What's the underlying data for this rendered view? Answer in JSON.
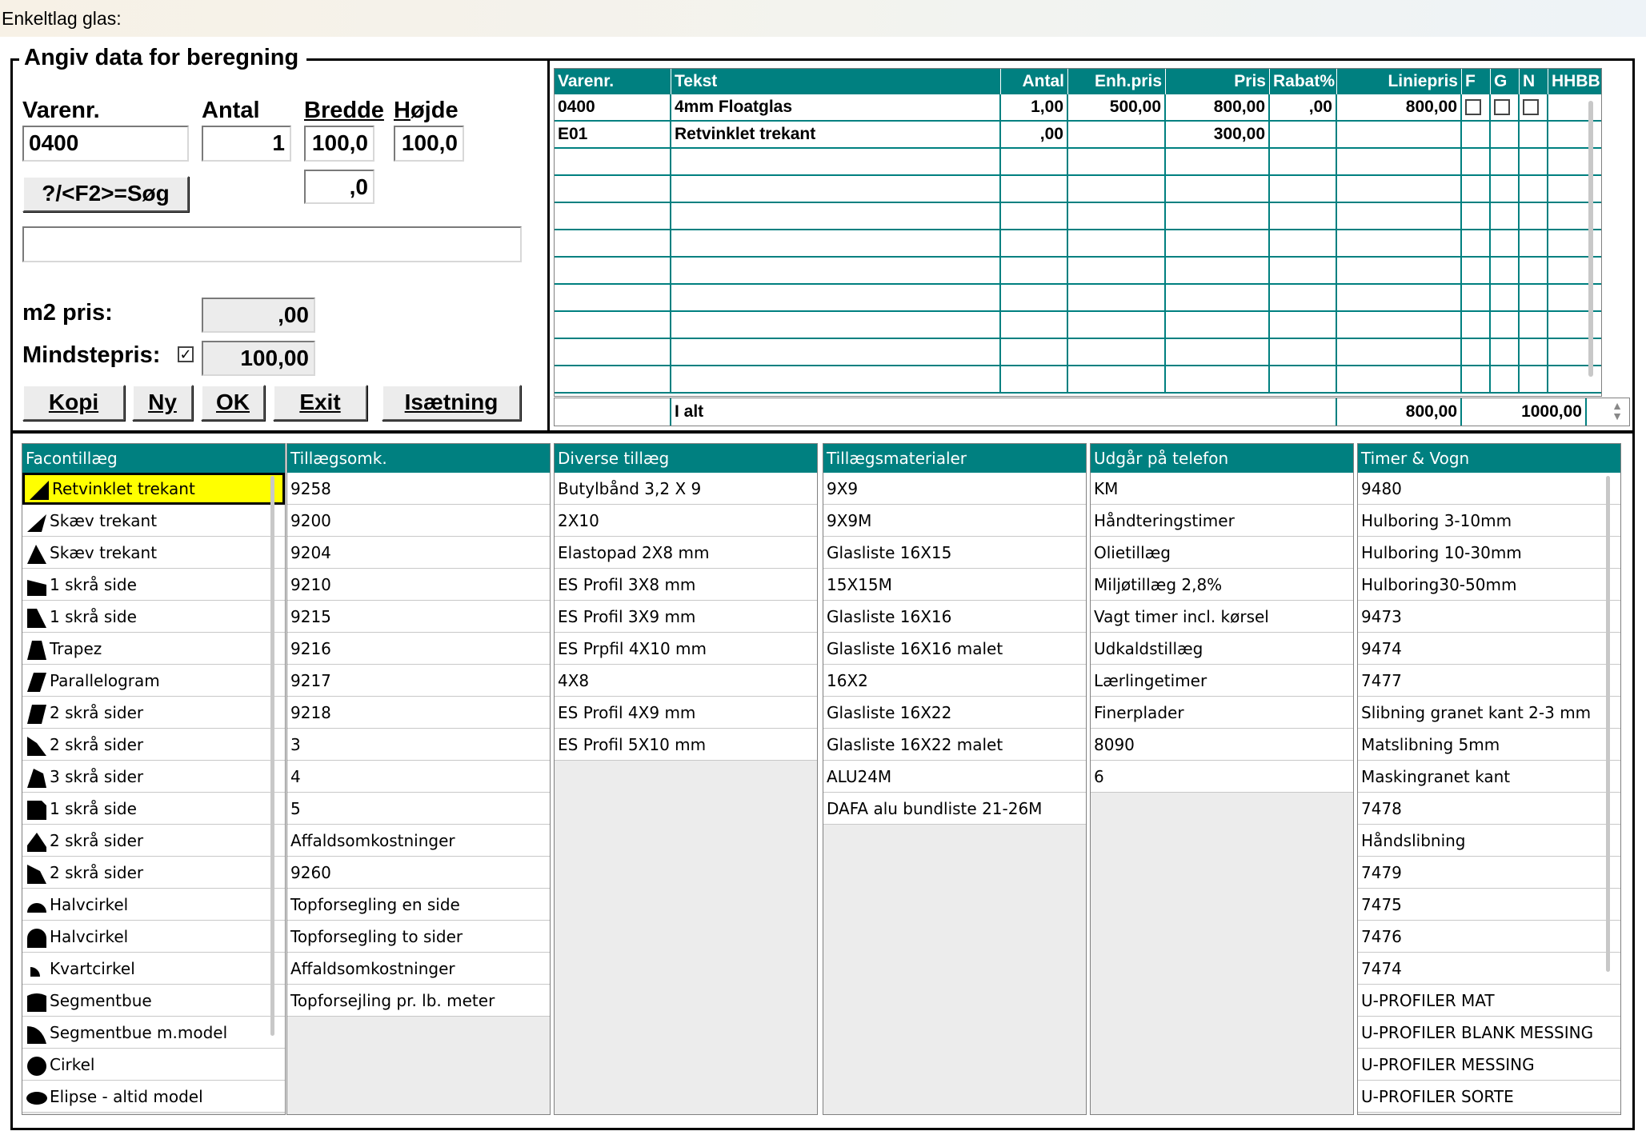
{
  "window": {
    "title": "Enkeltlag glas:"
  },
  "form": {
    "legend": "Angiv data for beregning",
    "varenr_label": "Varenr.",
    "antal_label": "Antal",
    "bredde_label": "Bredde",
    "hojde_label": "Højde",
    "varenr_value": "0400",
    "antal_value": "1",
    "bredde_value": "100,0",
    "hojde_value": "100,0",
    "extra_value": ",0",
    "search_button": "?/<F2>=Søg",
    "description_value": "",
    "m2_label": "m2 pris:",
    "m2_value": ",00",
    "mindstepris_label": "Mindstepris:",
    "mindstepris_checked": "✓",
    "mindstepris_value": "100,00",
    "buttons": {
      "kopi": "Kopi",
      "ny": "Ny",
      "ok": "OK",
      "exit": "Exit",
      "isaetning": "Isætning"
    }
  },
  "grid": {
    "columns": [
      "Varenr.",
      "Tekst",
      "Antal",
      "Enh.pris",
      "Pris",
      "Rabat%",
      "Liniepris",
      "F",
      "G",
      "N",
      "HHBB"
    ],
    "rows": [
      [
        "0400",
        "4mm Floatglas",
        "1,00",
        "500,00",
        "800,00",
        ",00",
        "800,00"
      ],
      [
        "E01",
        "Retvinklet trekant",
        ",00",
        "",
        "300,00",
        "",
        ""
      ]
    ],
    "totals": {
      "label": "I alt",
      "liniepris": "800,00",
      "total": "1000,00"
    }
  },
  "lists": {
    "facontillaeg": {
      "header": "Facontillæg",
      "items": [
        "Retvinklet trekant",
        "Skæv trekant",
        "Skæv trekant",
        "1 skrå side",
        "1 skrå side",
        "Trapez",
        "Parallelogram",
        "2 skrå sider",
        "2 skrå sider",
        "3 skrå sider",
        "1 skrå side",
        "2 skrå sider",
        "2 skrå sider",
        "Halvcirkel",
        "Halvcirkel",
        "Kvartcirkel",
        "Segmentbue",
        "Segmentbue m.model",
        "Cirkel",
        "Elipse - altid model"
      ]
    },
    "tillaegsomk": {
      "header": "Tillægsomk.",
      "items": [
        "9258",
        "9200",
        "9204",
        "9210",
        "9215",
        "9216",
        "9217",
        "9218",
        "3",
        "4",
        "5",
        "Affaldsomkostninger",
        "9260",
        "Topforsegling en side",
        "Topforsegling to sider",
        "Affaldsomkostninger",
        "Topforsejling pr. lb. meter"
      ]
    },
    "diverse": {
      "header": "Diverse tillæg",
      "items": [
        "Butylbånd 3,2 X 9",
        "2X10",
        "Elastopad 2X8 mm",
        "ES Profil 3X8 mm",
        "ES Profil 3X9 mm",
        "ES Prpfil 4X10 mm",
        "4X8",
        "ES Profil 4X9 mm",
        "ES Profil 5X10 mm"
      ]
    },
    "materialer": {
      "header": "Tillægsmaterialer",
      "items": [
        "9X9",
        "9X9M",
        "Glasliste 16X15",
        "15X15M",
        "Glasliste 16X16",
        "Glasliste 16X16 malet",
        "16X2",
        "Glasliste 16X22",
        "Glasliste 16X22 malet",
        "ALU24M",
        "DAFA alu bundliste 21-26M"
      ]
    },
    "telefon": {
      "header": "Udgår på telefon",
      "items": [
        "KM",
        "Håndteringstimer",
        "Olietillæg",
        "Miljøtillæg 2,8%",
        "Vagt timer incl. kørsel",
        "Udkaldstillæg",
        "Lærlingetimer",
        "Finerplader",
        "8090",
        "6"
      ]
    },
    "timer": {
      "header": "Timer & Vogn",
      "items": [
        "9480",
        "Hulboring 3-10mm",
        "Hulboring 10-30mm",
        "Hulboring30-50mm",
        "9473",
        "9474",
        "7477",
        "Slibning granet kant 2-3 mm",
        "Matslibning 5mm",
        "Maskingranet kant",
        "7478",
        "Håndslibning",
        "7479",
        "7475",
        "7476",
        "7474",
        "U-PROFILER MAT",
        "U-PROFILER BLANK MESSING",
        "U-PROFILER MESSING",
        "U-PROFILER SORTE"
      ]
    }
  },
  "colors": {
    "header_teal": "#008080",
    "selected": "#ffff00"
  },
  "icons": [
    "checkbox-icon",
    "scroll-arrows-icon",
    "shape-icons"
  ]
}
